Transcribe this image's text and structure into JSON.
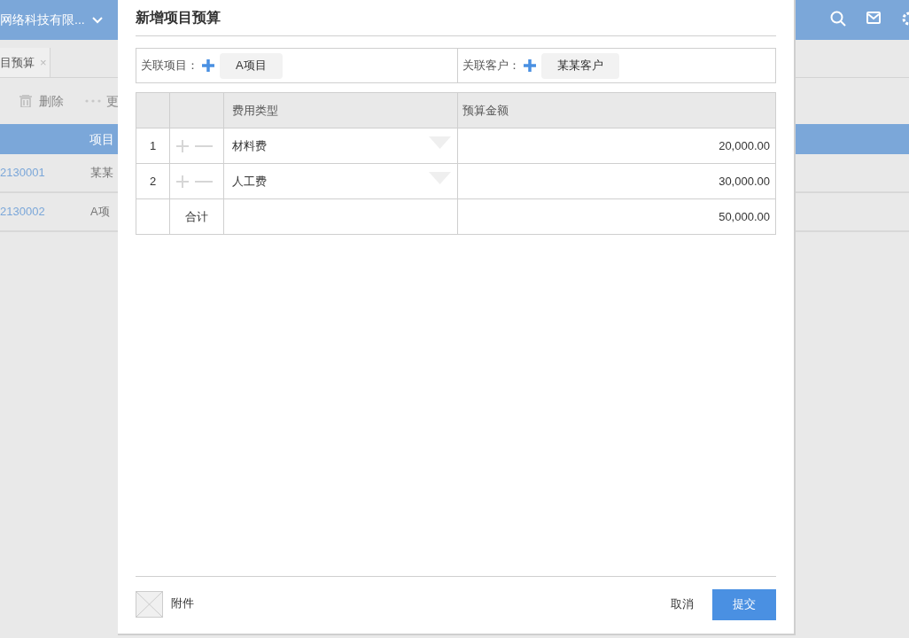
{
  "background": {
    "company": "网络科技有限...",
    "tab": {
      "label": "目预算",
      "close": "×"
    },
    "toolbar": [
      "删除",
      "更"
    ],
    "table": {
      "column": "项目",
      "rows": [
        {
          "code": "2130001",
          "name": "某某"
        },
        {
          "code": "2130002",
          "name": "A项"
        }
      ]
    }
  },
  "dialog": {
    "title": "新增项目预算",
    "links": [
      {
        "label": "关联项目：",
        "value": "A项目"
      },
      {
        "label": "关联客户：",
        "value": "某某客户"
      }
    ],
    "columns": [
      "费用类型",
      "预算金额"
    ],
    "rows": [
      {
        "index": "1",
        "type": "材料费",
        "amount": "20,000.00"
      },
      {
        "index": "2",
        "type": "人工费",
        "amount": "30,000.00"
      }
    ],
    "total": {
      "label": "合计",
      "amount": "50,000.00"
    },
    "attachment": "附件",
    "cancel": "取消",
    "submit": "提交"
  }
}
